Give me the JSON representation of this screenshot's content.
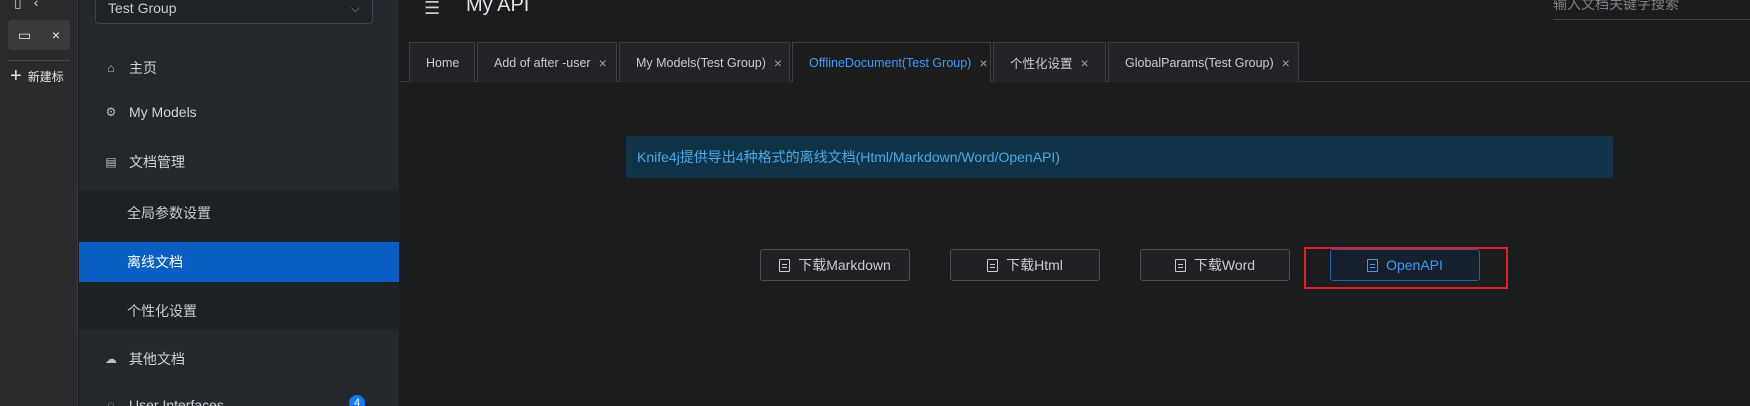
{
  "browser": {
    "tab_close": "×",
    "new_tab_label": "新建标"
  },
  "sidebar": {
    "group_select": {
      "value": "Test Group"
    },
    "items": [
      {
        "label": "主页",
        "icon": "home-icon"
      },
      {
        "label": "My Models",
        "icon": "models-icon"
      },
      {
        "label": "文档管理",
        "icon": "document-manage-icon"
      },
      {
        "label": "其他文档",
        "icon": "cloud-icon"
      },
      {
        "label": "User Interfaces",
        "icon": "api-icon",
        "badge": "4"
      }
    ],
    "subitems": [
      {
        "label": "全局参数设置",
        "active": false
      },
      {
        "label": "离线文档",
        "active": true
      },
      {
        "label": "个性化设置",
        "active": false
      }
    ]
  },
  "header": {
    "title": "My API",
    "search_placeholder": "输入文档关键字搜索"
  },
  "tabs": [
    {
      "label": "Home",
      "closable": false
    },
    {
      "label": "Add of after -user",
      "closable": true
    },
    {
      "label": "My Models(Test Group)",
      "closable": true
    },
    {
      "label": "OfflineDocument(Test Group)",
      "closable": true,
      "active": true
    },
    {
      "label": "个性化设置",
      "closable": true
    },
    {
      "label": "GlobalParams(Test Group)",
      "closable": true
    }
  ],
  "notice": "Knife4j提供导出4种格式的离线文档(Html/Markdown/Word/OpenAPI)",
  "buttons": [
    {
      "label": "下载Markdown",
      "icon": "markdown-file-icon"
    },
    {
      "label": "下载Html",
      "icon": "html-file-icon"
    },
    {
      "label": "下载Word",
      "icon": "word-file-icon"
    },
    {
      "label": "OpenAPI",
      "icon": "openapi-file-icon",
      "primary": true
    }
  ],
  "colors": {
    "accent": "#3c9bff",
    "active_menu": "#0a5fc2",
    "highlight": "#e81c23",
    "notice_bg": "#0f3447"
  }
}
